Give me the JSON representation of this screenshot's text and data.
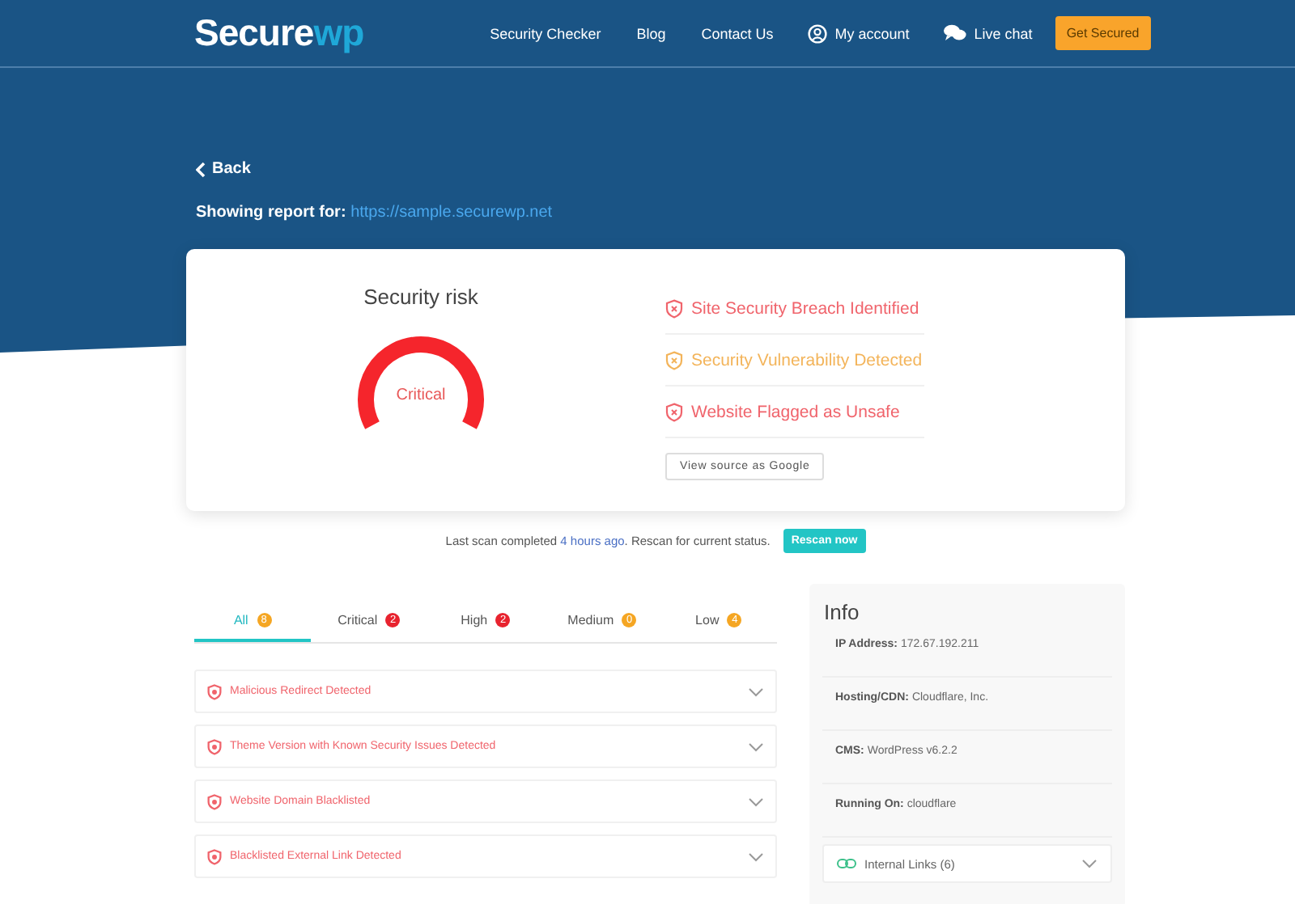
{
  "header": {
    "logo": {
      "part_1": "Secure",
      "part_2": "wp"
    },
    "nav": [
      "Security Checker",
      "Blog",
      "Contact Us"
    ],
    "account": "My account",
    "chat": "Live chat",
    "cta": "Get Secured"
  },
  "back": "Back",
  "report": {
    "label": "Showing report for:",
    "url": "https://sample.securewp.net"
  },
  "risk": {
    "title": "Security risk",
    "level_text": "Critical",
    "issues": [
      {
        "text": "Site Security Breach Identified",
        "color": "#f0646c"
      },
      {
        "text": "Security Vulnerability Detected",
        "color": "#f3b45a"
      },
      {
        "text": "Website Flagged as Unsafe",
        "color": "#f0646c"
      }
    ],
    "source_button": "View source as Google"
  },
  "scan": {
    "before": "Last scan completed ",
    "link": "4 hours ago",
    "after": ". Rescan for current status.",
    "button": "Rescan now"
  },
  "tabs": [
    {
      "label": "All",
      "count": "8",
      "color": "#f5a623",
      "selected": true
    },
    {
      "label": "Critical",
      "count": "2",
      "color": "#e8232f",
      "selected": false
    },
    {
      "label": "High",
      "count": "2",
      "color": "#e8232f",
      "selected": false
    },
    {
      "label": "Medium",
      "count": "0",
      "color": "#f5a623",
      "selected": false
    },
    {
      "label": "Low",
      "count": "4",
      "color": "#f5a623",
      "selected": false
    }
  ],
  "findings": [
    {
      "text": "Malicious Redirect Detected",
      "color": "#f0646c"
    },
    {
      "text": "Theme Version with Known Security Issues Detected",
      "color": "#f0646c"
    },
    {
      "text": "Website Domain Blacklisted",
      "color": "#f0646c"
    },
    {
      "text": "Blacklisted External Link Detected",
      "color": "#f0646c"
    }
  ],
  "info": {
    "title": "Info",
    "rows": [
      {
        "label": "IP Address:",
        "value": "172.67.192.211"
      },
      {
        "label": "Hosting/CDN:",
        "value": "Cloudflare, Inc."
      },
      {
        "label": "CMS:",
        "value": "WordPress v6.2.2"
      },
      {
        "label": "Running On:",
        "value": "cloudflare"
      }
    ],
    "links": "Internal Links (6)"
  }
}
